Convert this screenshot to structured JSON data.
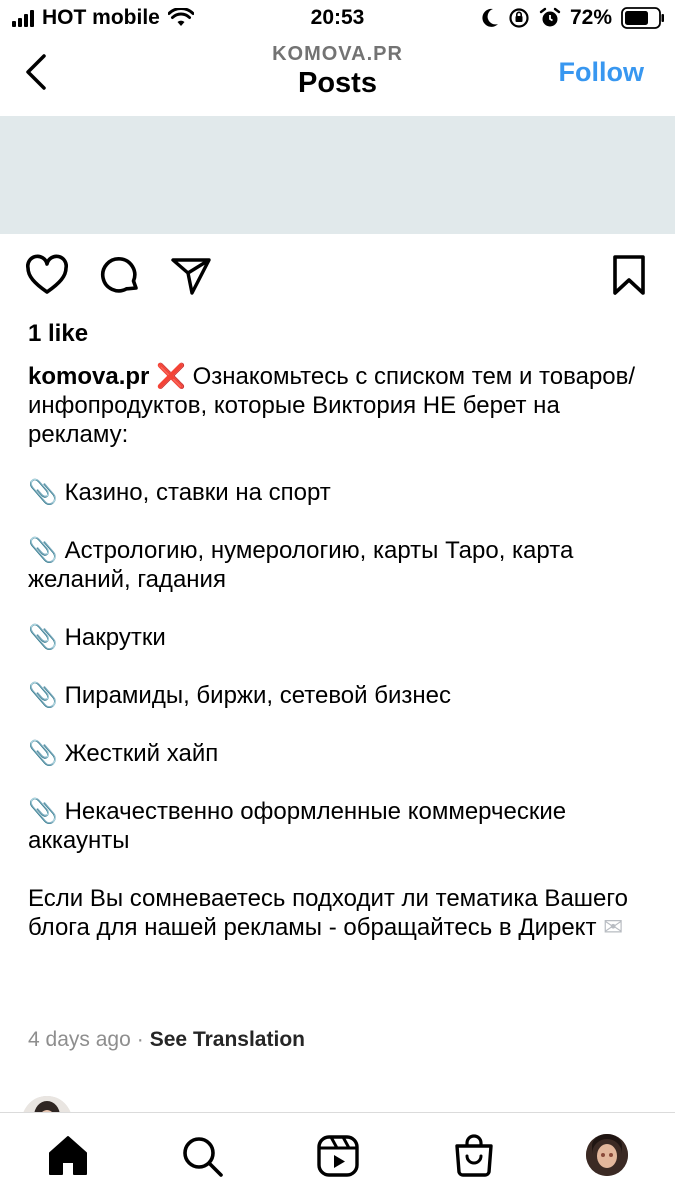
{
  "status_bar": {
    "carrier": "HOT mobile",
    "time": "20:53",
    "battery": "72%"
  },
  "header": {
    "account": "KOMOVA.PR",
    "title": "Posts",
    "follow_label": "Follow"
  },
  "post": {
    "likes": "1 like",
    "username": "komova.pr",
    "caption_intro": "Ознакомьтесь с списком тем и товаров/инфопродуктов, которые Виктория НЕ берет на рекламу:",
    "items": [
      "Казино, ставки на спорт",
      "Астрологию, нумерологию, карты Таро, карта желаний, гадания",
      "Накрутки",
      "Пирамиды, биржи, сетевой бизнес",
      "Жесткий хайп",
      "Некачественно оформленные коммерческие аккаунты"
    ],
    "outro": "Если Вы сомневаетесь подходит ли тематика Вашего блога для нашей рекламы - обращайтесь в Директ",
    "time_ago": "4 days ago",
    "separator": "·",
    "see_translation": "See Translation"
  },
  "icons": {
    "bullet": "paperclip-icon",
    "intro": "cross-mark-icon",
    "outro": "envelope-icon"
  },
  "colors": {
    "follow": "#3897f0",
    "image_placeholder": "#e1e9eb",
    "meta_gray": "#8e8e8e"
  }
}
